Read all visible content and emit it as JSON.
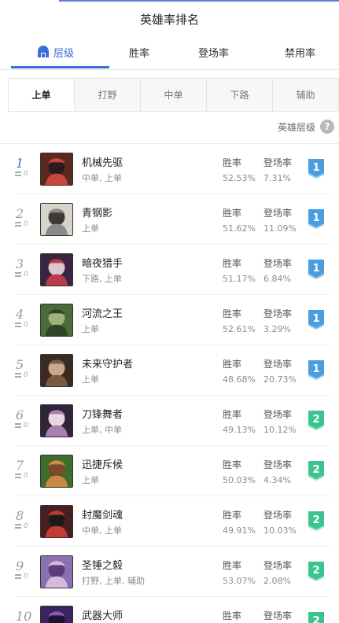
{
  "header": {
    "title": "英雄率排名"
  },
  "tabs": [
    {
      "label": "层级",
      "icon": "helmet-icon",
      "active": true
    },
    {
      "label": "胜率",
      "active": false
    },
    {
      "label": "登场率",
      "active": false
    },
    {
      "label": "禁用率",
      "active": false
    }
  ],
  "positions": [
    {
      "label": "上单",
      "active": true
    },
    {
      "label": "打野",
      "active": false
    },
    {
      "label": "中单",
      "active": false
    },
    {
      "label": "下路",
      "active": false
    },
    {
      "label": "辅助",
      "active": false
    }
  ],
  "tier_link": {
    "label": "英雄层级",
    "icon": "question-icon"
  },
  "stat_labels": {
    "win": "胜率",
    "pick": "登场率"
  },
  "colors": {
    "accent": "#3b6fd6",
    "tier1": "#4a9ee0",
    "tier2": "#3cc48f"
  },
  "heroes": [
    {
      "rank": "1",
      "change": "0",
      "name": "机械先驱",
      "roles": "中单, 上单",
      "win_rate": "52.53%",
      "pick_rate": "7.31%",
      "tier": "1"
    },
    {
      "rank": "2",
      "change": "0",
      "name": "青钢影",
      "roles": "上单",
      "win_rate": "51.62%",
      "pick_rate": "11.09%",
      "tier": "1"
    },
    {
      "rank": "3",
      "change": "0",
      "name": "暗夜猎手",
      "roles": "下路, 上单",
      "win_rate": "51.17%",
      "pick_rate": "6.84%",
      "tier": "1"
    },
    {
      "rank": "4",
      "change": "0",
      "name": "河流之王",
      "roles": "上单",
      "win_rate": "52.61%",
      "pick_rate": "3.29%",
      "tier": "1"
    },
    {
      "rank": "5",
      "change": "0",
      "name": "未来守护者",
      "roles": "上单",
      "win_rate": "48.68%",
      "pick_rate": "20.73%",
      "tier": "1"
    },
    {
      "rank": "6",
      "change": "0",
      "name": "刀锋舞者",
      "roles": "上单, 中单",
      "win_rate": "49.13%",
      "pick_rate": "10.12%",
      "tier": "2"
    },
    {
      "rank": "7",
      "change": "0",
      "name": "迅捷斥候",
      "roles": "上单",
      "win_rate": "50.03%",
      "pick_rate": "4.34%",
      "tier": "2"
    },
    {
      "rank": "8",
      "change": "0",
      "name": "封魔剑魂",
      "roles": "中单, 上单",
      "win_rate": "49.91%",
      "pick_rate": "10.03%",
      "tier": "2"
    },
    {
      "rank": "9",
      "change": "0",
      "name": "圣锤之毅",
      "roles": "打野, 上单, 辅助",
      "win_rate": "53.07%",
      "pick_rate": "2.08%",
      "tier": "2"
    },
    {
      "rank": "10",
      "change": "0",
      "name": "武器大师",
      "roles": "",
      "win_rate": "",
      "pick_rate": "",
      "tier": "2"
    }
  ]
}
